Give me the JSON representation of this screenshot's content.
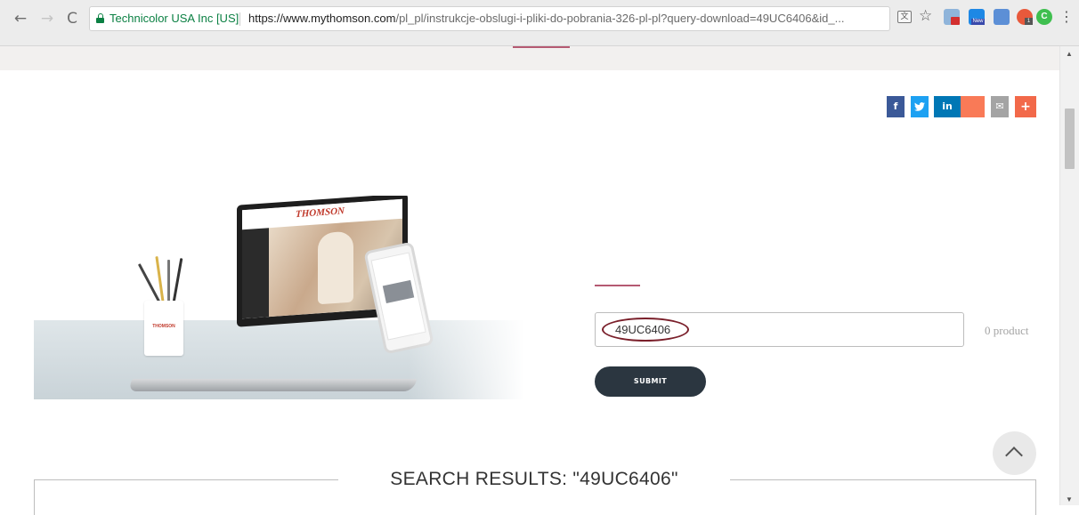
{
  "browser": {
    "site_name": "Technicolor USA Inc [US]",
    "url_host": "https://www.mythomson.com",
    "url_path": "/pl_pl/instrukcje-obslugi-i-pliki-do-pobrania-326-pl-pl?query-download=49UC6406&id_...",
    "nav_back": "←",
    "nav_forward": "→",
    "nav_reload": "C",
    "ext_badge_new": "New",
    "ext_badge_count": "1",
    "ext_green_letter": "C",
    "menu_icon": "⋮"
  },
  "share": {
    "facebook": "f",
    "twitter": "t",
    "linkedin": "in",
    "mail": "✉",
    "more": "+"
  },
  "hero": {
    "brand": "THOMSON",
    "cup_label": "THOMSON"
  },
  "search": {
    "value": "49UC6406",
    "count_label": "0 product",
    "submit_label": "SUBMIT"
  },
  "results": {
    "title": "SEARCH RESULTS: \"49UC6406\""
  },
  "colors": {
    "accent": "#b55a72",
    "submit_bg": "#2b3640",
    "annotation_circle": "#7a1f2a"
  }
}
